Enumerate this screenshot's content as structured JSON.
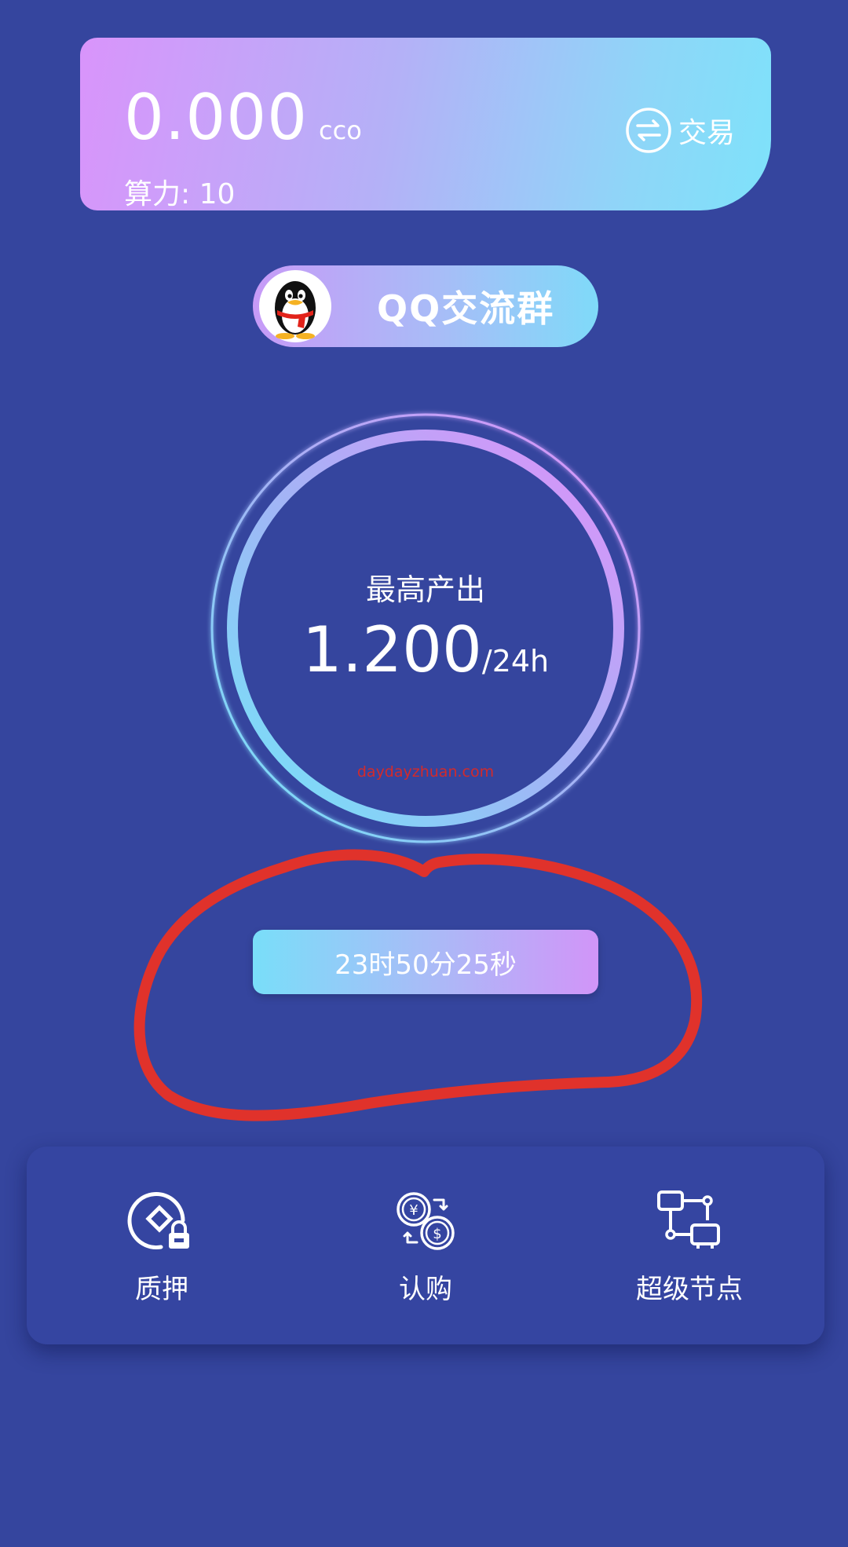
{
  "balance": {
    "value": "0.000",
    "unit": "cco",
    "hashrate_label": "算力: 10",
    "trade_label": "交易"
  },
  "qq_group": {
    "label": "QQ交流群",
    "icon": "qq-penguin-icon"
  },
  "production": {
    "title": "最高产出",
    "value": "1.200",
    "unit": "/24h",
    "watermark": "daydayzhuan.com"
  },
  "countdown": {
    "text": "23时50分25秒"
  },
  "actions": [
    {
      "label": "质押",
      "icon": "pledge-lock-icon"
    },
    {
      "label": "认购",
      "icon": "currency-exchange-icon"
    },
    {
      "label": "超级节点",
      "icon": "node-network-icon"
    }
  ],
  "colors": {
    "background": "#35459e",
    "card_gradient_start": "#d994fb",
    "card_gradient_end": "#7ee2fa",
    "scribble": "#e0322b",
    "watermark": "#d42a2a"
  }
}
